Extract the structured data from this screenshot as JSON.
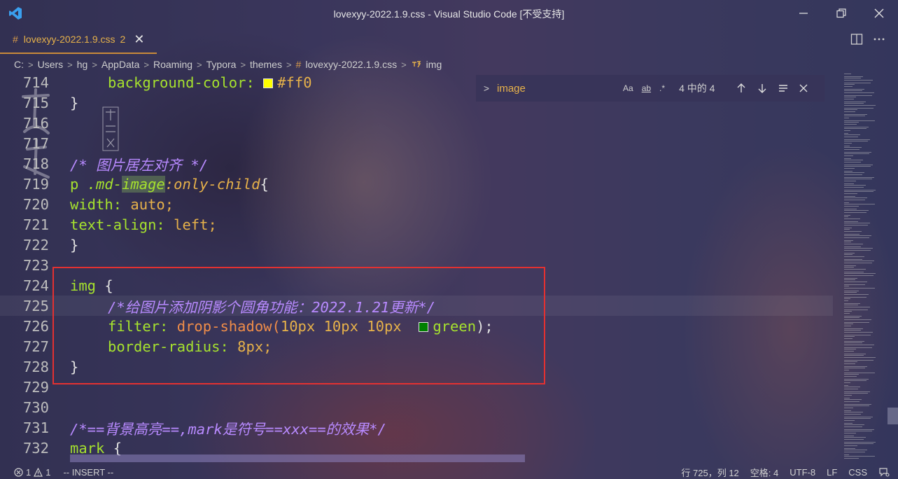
{
  "window": {
    "title": "lovexyy-2022.1.9.css - Visual Studio Code [不受支持]"
  },
  "tabs": [
    {
      "hash": "#",
      "label": "lovexyy-2022.1.9.css",
      "badge": "2",
      "close": "✕",
      "active": true
    }
  ],
  "breadcrumb": {
    "items": [
      "C:",
      "Users",
      "hg",
      "AppData",
      "Roaming",
      "Typora",
      "themes"
    ],
    "file_hash": "#",
    "file": "lovexyy-2022.1.9.css",
    "symbol": "img",
    "separator": ">"
  },
  "find_widget": {
    "toggle": ">",
    "query": "image",
    "match_case": "Aa",
    "whole_word": "ab",
    "regex": ".*",
    "count": "4 中的 4"
  },
  "code": {
    "lines": [
      {
        "n": "714"
      },
      {
        "n": "715"
      },
      {
        "n": "716"
      },
      {
        "n": "717"
      },
      {
        "n": "718"
      },
      {
        "n": "719"
      },
      {
        "n": "720"
      },
      {
        "n": "721"
      },
      {
        "n": "722"
      },
      {
        "n": "723"
      },
      {
        "n": "724"
      },
      {
        "n": "725"
      },
      {
        "n": "726"
      },
      {
        "n": "727"
      },
      {
        "n": "728"
      },
      {
        "n": "729"
      },
      {
        "n": "730"
      },
      {
        "n": "731"
      },
      {
        "n": "732"
      }
    ],
    "t714_prop": "background-color:",
    "t714_val": "#ff0",
    "t715": "}",
    "t718": "/* 图片居左对齐 */",
    "t719_sel": "p",
    "t719_cls": ".md-",
    "t719_hl": "image",
    "t719_pseudo": ":only-child",
    "t719_brace": "{",
    "t720_prop": "width:",
    "t720_val": "auto;",
    "t721_prop": "text-align:",
    "t721_val": "left;",
    "t722": "}",
    "t724_sel": "img",
    "t724_brace": "{",
    "t725": "/*给图片添加阴影个圆角功能：2022.1.21更新*/",
    "t726_prop": "filter:",
    "t726_func": "drop-shadow(",
    "t726_nums": "10px 10px 10px",
    "t726_color": "green",
    "t726_end": ");",
    "t727_prop": "border-radius:",
    "t727_val": "8px;",
    "t728": "}",
    "t731": "/*==背景高亮==,mark是符号==xxx==的效果*/",
    "t732_sel": "mark",
    "t732_brace": "{"
  },
  "status": {
    "errors": "1",
    "warnings": "1",
    "mode": "-- INSERT --",
    "position": "行 725，列 12",
    "spaces": "空格: 4",
    "encoding": "UTF-8",
    "eol": "LF",
    "language": "CSS"
  },
  "watermark": {
    "text": "西小书"
  },
  "colors": {
    "accent": "#e6b14a",
    "highlight_border": "#e33131",
    "swatch_yellow": "#ffff00",
    "swatch_green": "#008000"
  }
}
